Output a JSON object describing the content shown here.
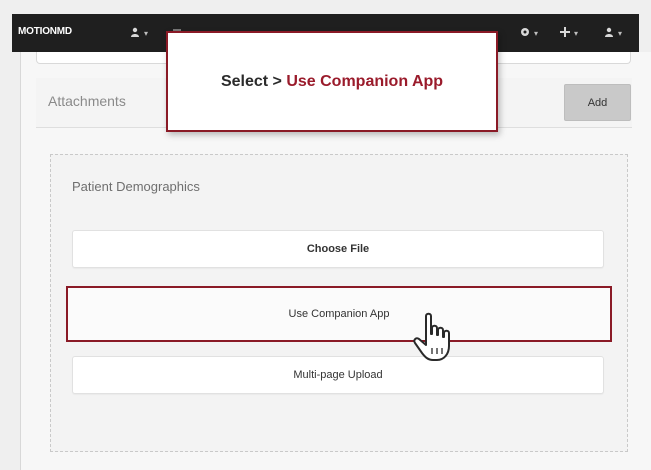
{
  "navbar": {
    "brand": "MOTIONMD",
    "items": [
      {
        "icon": "user-icon",
        "caret": "▾"
      },
      {
        "icon": "calendar-icon",
        "caret": ""
      },
      {
        "icon": "messages-icon",
        "caret": ""
      },
      {
        "icon": "print-icon",
        "caret": ""
      },
      {
        "icon": "settings-icon",
        "caret": ""
      }
    ],
    "right_items": [
      {
        "icon": "help-icon",
        "caret": "▾"
      },
      {
        "icon": "add-icon",
        "caret": "▾"
      },
      {
        "icon": "account-icon",
        "caret": "▾"
      }
    ]
  },
  "callout": {
    "prefix": "Select > ",
    "highlight": "Use Companion App"
  },
  "attachments": {
    "title": "Attachments",
    "add_label": "Add"
  },
  "dropzone": {
    "section_label": "Patient Demographics",
    "choose_file_label": "Choose File",
    "companion_label": "Use Companion App",
    "multipage_label": "Multi-page Upload"
  },
  "colors": {
    "navbar": "#1f1f1f",
    "accent": "#8a1a26",
    "add_button": "#c9c9c9"
  }
}
